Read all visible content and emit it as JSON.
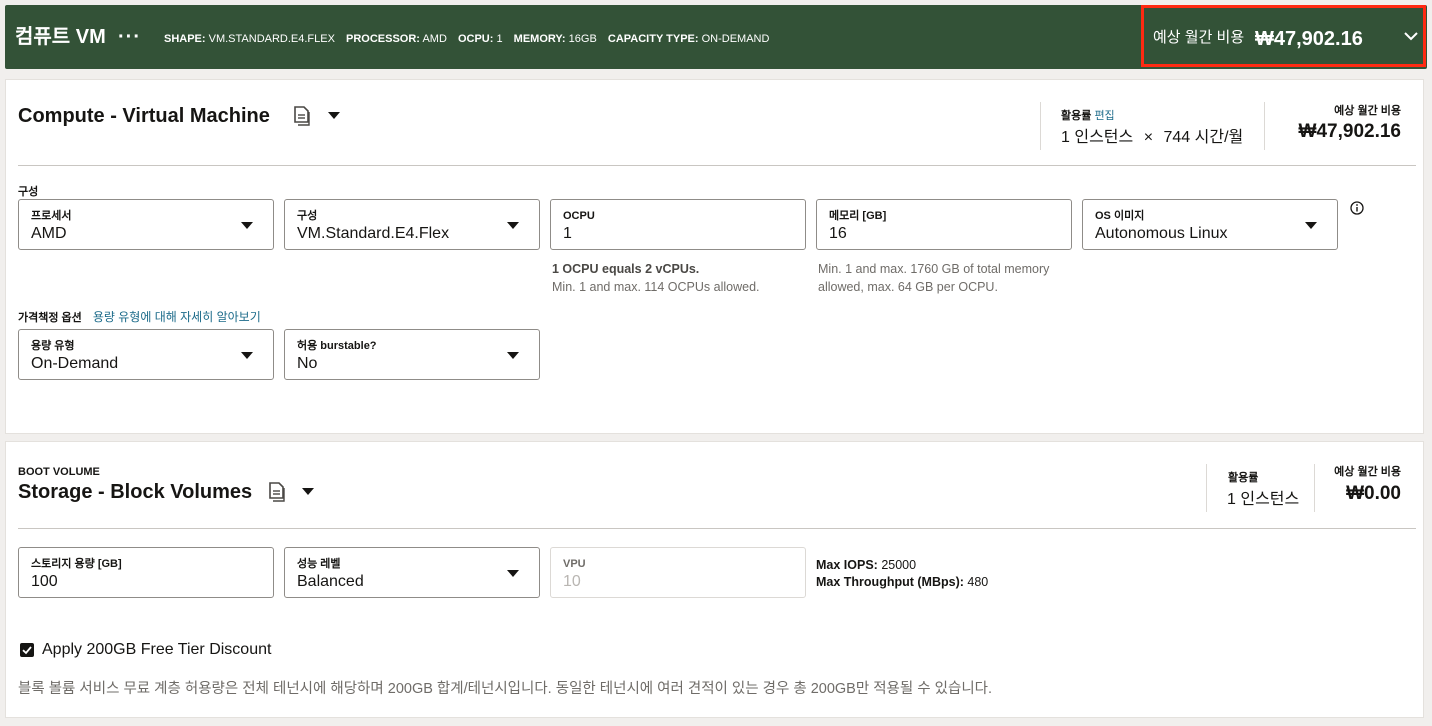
{
  "header": {
    "title": "컴퓨트 VM",
    "more_icon": "ellipsis-icon",
    "specs": [
      {
        "key": "SHAPE:",
        "value": "VM.STANDARD.E4.FLEX"
      },
      {
        "key": "PROCESSOR:",
        "value": "AMD"
      },
      {
        "key": "OCPU:",
        "value": "1"
      },
      {
        "key": "MEMORY:",
        "value": "16GB"
      },
      {
        "key": "CAPACITY TYPE:",
        "value": "ON-DEMAND"
      }
    ],
    "cost_label": "예상 월간 비용",
    "cost_value": "₩47,902.16",
    "expand_icon": "chevron-down-icon",
    "highlight_color": "#ff2a12",
    "bg_color": "#335237"
  },
  "compute": {
    "title": "Compute - Virtual Machine",
    "utilization": {
      "label": "활용률",
      "edit_link": "편집",
      "instances": "1 인스턴스",
      "times": "×",
      "hours": "744 시간/월"
    },
    "monthly_cost": {
      "label": "예상 월간 비용",
      "value": "₩47,902.16"
    },
    "config_label": "구성",
    "fields": {
      "processor": {
        "label": "프로세서",
        "value": "AMD"
      },
      "shape": {
        "label": "구성",
        "value": "VM.Standard.E4.Flex"
      },
      "ocpu": {
        "label": "OCPU",
        "value": "1"
      },
      "memory": {
        "label": "메모리 [GB]",
        "value": "16"
      },
      "os_image": {
        "label": "OS 이미지",
        "value": "Autonomous Linux"
      }
    },
    "ocpu_help": {
      "strong": "1 OCPU equals 2 vCPUs.",
      "text": "Min. 1 and max. 114 OCPUs allowed."
    },
    "memory_help": {
      "line1": "Min. 1 and max. 1760 GB of total memory",
      "line2": "allowed, max. 64 GB per OCPU."
    },
    "pricing_label": "가격책정 옵션",
    "pricing_link": "용량 유형에 대해 자세히 알아보기",
    "pricing_fields": {
      "capacity_type": {
        "label": "용량 유형",
        "value": "On-Demand"
      },
      "burstable": {
        "label": "허용 burstable?",
        "value": "No"
      }
    }
  },
  "storage": {
    "overline": "BOOT VOLUME",
    "title": "Storage - Block Volumes",
    "utilization": {
      "label": "활용률",
      "instances": "1 인스턴스"
    },
    "monthly_cost": {
      "label": "예상 월간 비용",
      "value": "₩0.00"
    },
    "fields": {
      "capacity": {
        "label": "스토리지 용량 [GB]",
        "value": "100"
      },
      "performance": {
        "label": "성능 레벨",
        "value": "Balanced"
      },
      "vpu": {
        "label": "VPU",
        "value": "10"
      }
    },
    "stats": {
      "iops_label": "Max IOPS:",
      "iops_value": "25000",
      "throughput_label": "Max Throughput (MBps):",
      "throughput_value": "480"
    },
    "free_tier": {
      "label": "Apply 200GB Free Tier Discount",
      "checked": true
    },
    "note": "블록 볼륨 서비스 무료 계층 허용량은 전체 테넌시에 해당하며 200GB 합계/테넌시입니다. 동일한 테넌시에 여러 견적이 있는 경우 총 200GB만 적용될 수 있습니다."
  }
}
